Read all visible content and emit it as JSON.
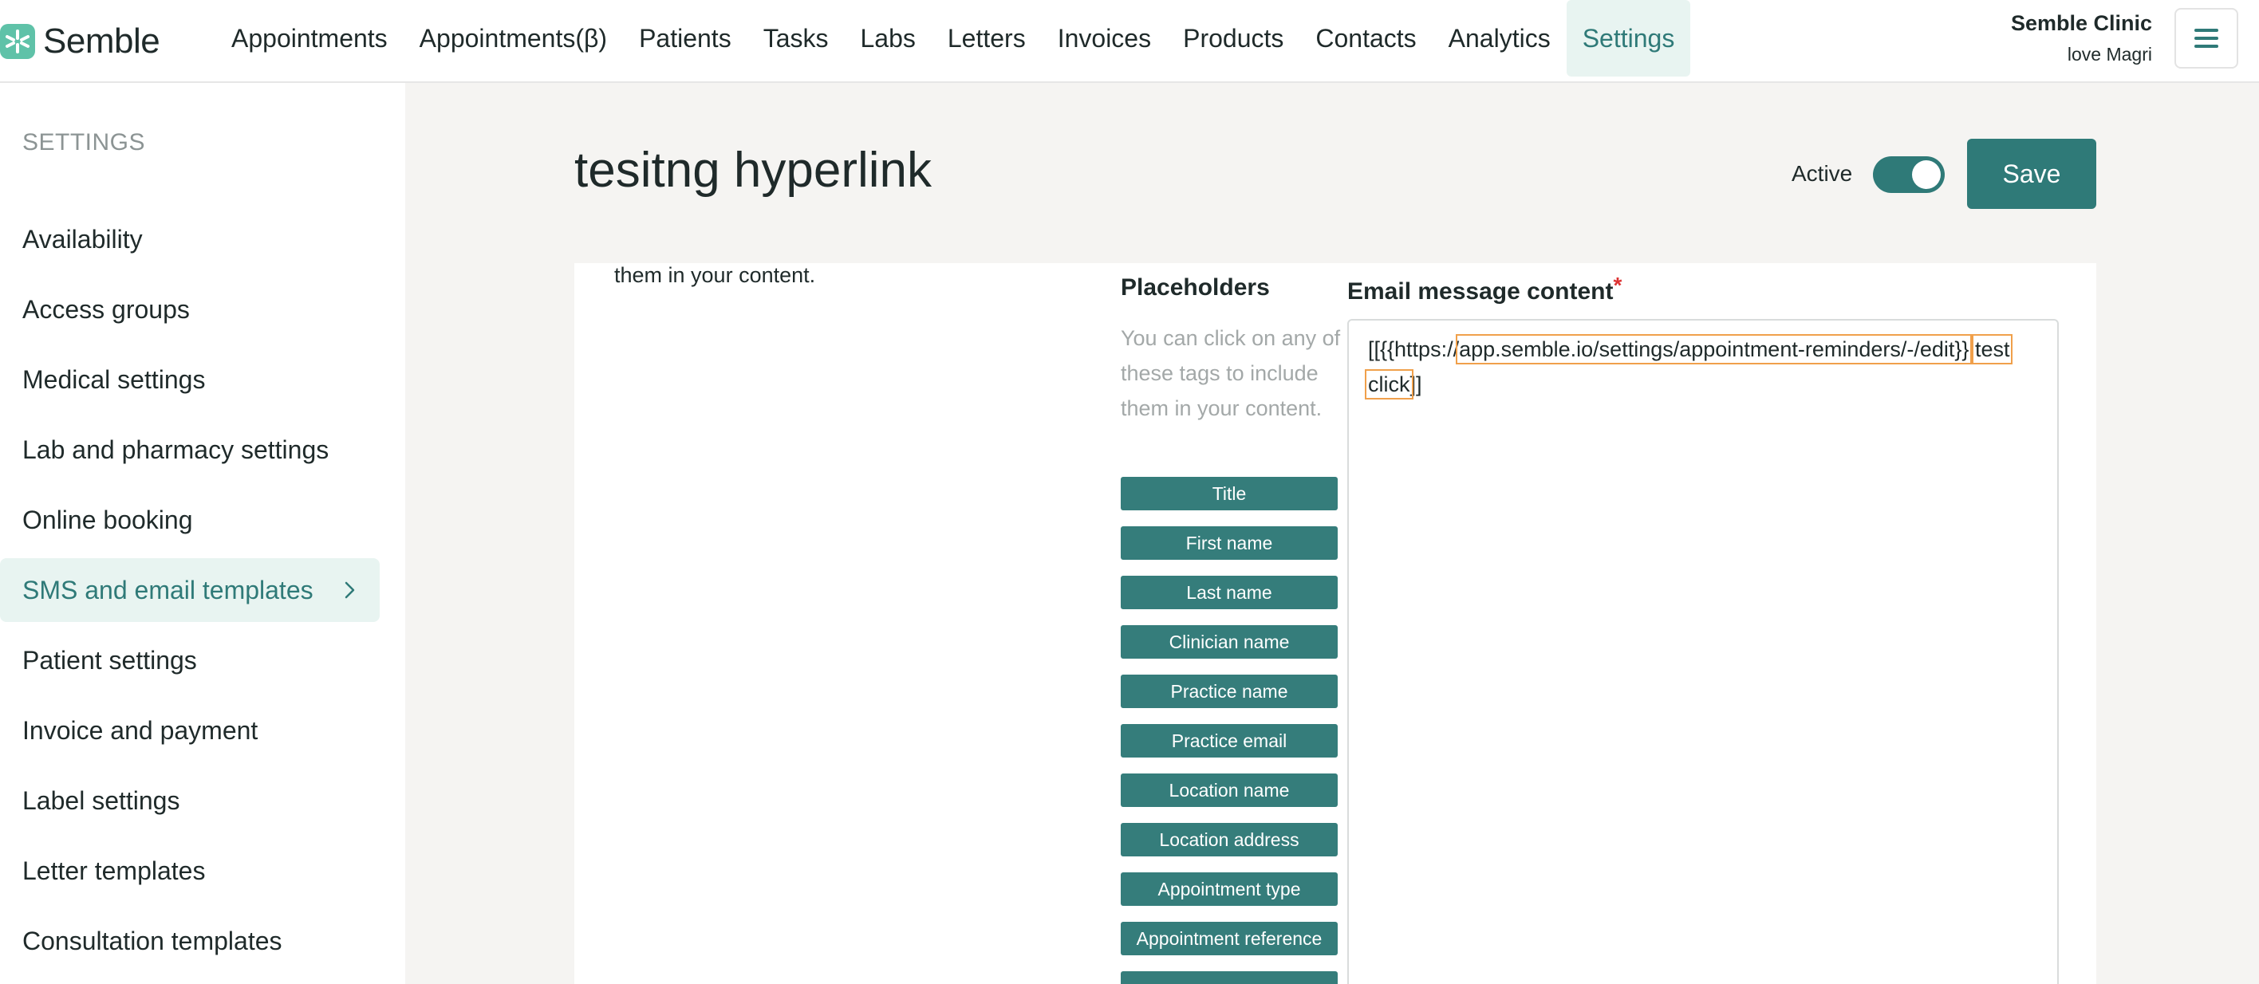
{
  "app": {
    "logo_text": "Semble",
    "clinic_name": "Semble Clinic",
    "user_name": "love Magri"
  },
  "nav": [
    {
      "label": "Appointments"
    },
    {
      "label": "Appointments(β)"
    },
    {
      "label": "Patients"
    },
    {
      "label": "Tasks"
    },
    {
      "label": "Labs"
    },
    {
      "label": "Letters"
    },
    {
      "label": "Invoices"
    },
    {
      "label": "Products"
    },
    {
      "label": "Contacts"
    },
    {
      "label": "Analytics"
    },
    {
      "label": "Settings",
      "active": true
    }
  ],
  "sidebar": {
    "heading": "SETTINGS",
    "items": [
      {
        "label": "Availability"
      },
      {
        "label": "Access groups"
      },
      {
        "label": "Medical settings"
      },
      {
        "label": "Lab and pharmacy settings"
      },
      {
        "label": "Online booking"
      },
      {
        "label": "SMS and email templates",
        "active": true
      },
      {
        "label": "Patient settings"
      },
      {
        "label": "Invoice and payment"
      },
      {
        "label": "Label settings"
      },
      {
        "label": "Letter templates"
      },
      {
        "label": "Consultation templates"
      }
    ]
  },
  "page": {
    "title": "tesitng hyperlink",
    "active_label": "Active",
    "active_on": true,
    "save_label": "Save"
  },
  "card": {
    "intro_text": "them in your content.",
    "placeholders_title": "Placeholders",
    "placeholders_help": "You can click on any of these tags to include them in your content.",
    "placeholders": [
      "Title",
      "First name",
      "Last name",
      "Clinician name",
      "Practice name",
      "Practice email",
      "Location name",
      "Location address",
      "Appointment type",
      "Appointment reference"
    ],
    "email_title": "Email message content",
    "required_mark": "*",
    "email_parts": {
      "p1": "[[{{https://",
      "p2": "app.semble.io/settings/appointment-reminders/-/edit}}",
      "p3": ".",
      "p4": "test",
      "p5": "click",
      "p6": "]]"
    }
  },
  "colors": {
    "primary": "#2f7a78",
    "logo": "#5fc2a8",
    "active_bg": "#e8f4f1",
    "highlight_outline": "#f0a04b"
  }
}
